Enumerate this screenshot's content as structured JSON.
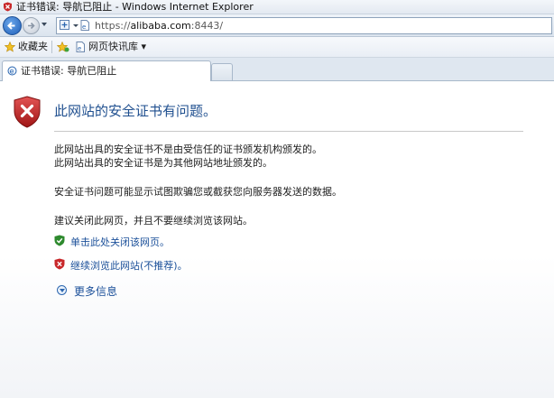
{
  "window": {
    "title": "证书错误: 导航已阻止 - Windows Internet Explorer"
  },
  "addressbar": {
    "url_prefix": "https://",
    "url_host": "alibaba.com",
    "url_suffix": ":8443/"
  },
  "favorites": {
    "favorites_label": "收藏夹",
    "web_slice_label": "网页快讯库 ▾"
  },
  "tab": {
    "label": "证书错误: 导航已阻止"
  },
  "page": {
    "heading": "此网站的安全证书有问题。",
    "p1_line1": "此网站出具的安全证书不是由受信任的证书颁发机构颁发的。",
    "p1_line2": "此网站出具的安全证书是为其他网站地址颁发的。",
    "p2": "安全证书问题可能显示试图欺骗您或截获您向服务器发送的数据。",
    "p3": "建议关闭此网页，并且不要继续浏览该网站。",
    "close_link": "单击此处关闭该网页。",
    "continue_link": "继续浏览此网站(不推荐)。",
    "more_info": "更多信息"
  },
  "colors": {
    "link": "#1a4f99",
    "heading": "#1f4f8f",
    "danger": "#c8282a",
    "safe": "#2e8a2e"
  }
}
